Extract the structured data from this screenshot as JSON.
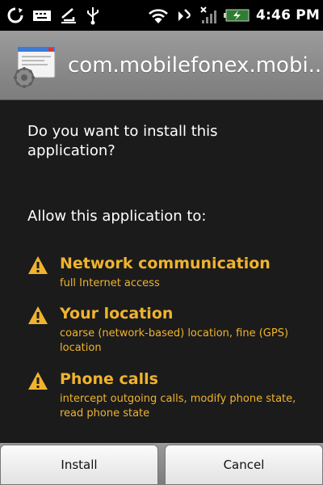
{
  "status_bar": {
    "time": "4:46 PM",
    "left_icons": [
      "sync-icon",
      "keyboard-icon",
      "download-icon",
      "usb-icon"
    ],
    "right_icons": [
      "wifi-icon",
      "gps-icon",
      "signal-icon",
      "battery-icon"
    ]
  },
  "title_bar": {
    "icon": "package-installer-icon",
    "title": "com.mobilefonex.mobi..."
  },
  "content": {
    "question": "Do you want to install this application?",
    "allow_heading": "Allow this application to:",
    "permissions": [
      {
        "title": "Network communication",
        "description": "full Internet access"
      },
      {
        "title": "Your location",
        "description": "coarse (network-based) location, fine (GPS) location"
      },
      {
        "title": "Phone calls",
        "description": "intercept outgoing calls, modify phone state, read phone state"
      }
    ]
  },
  "buttons": {
    "install": "Install",
    "cancel": "Cancel"
  },
  "colors": {
    "warning_text": "#f0b32e",
    "background": "#1b1b1b",
    "title_bar": "#888888"
  }
}
